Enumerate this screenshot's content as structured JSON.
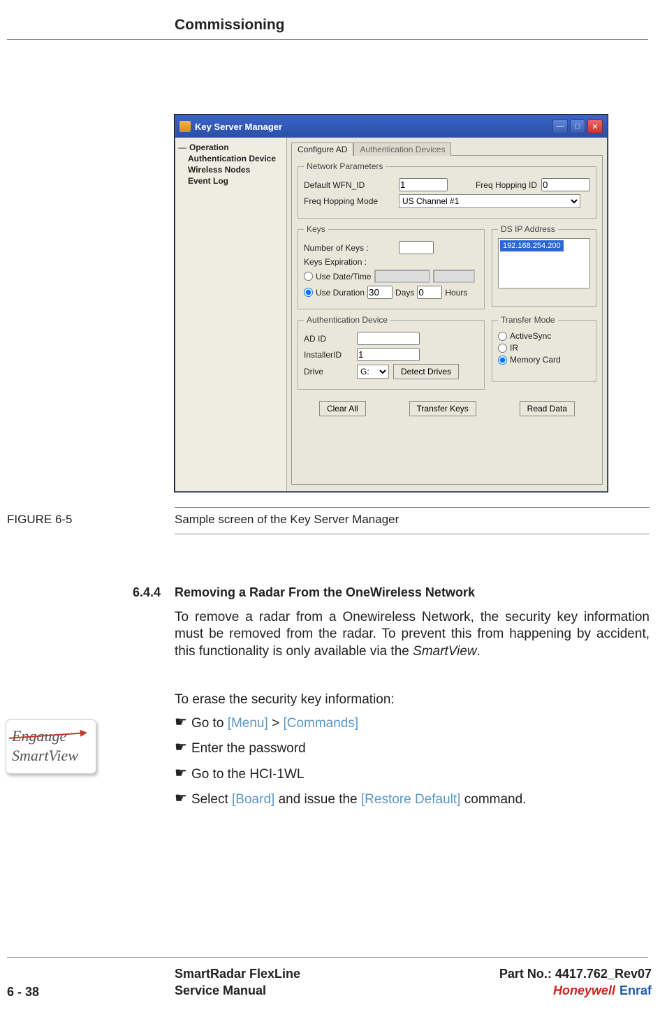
{
  "header": {
    "title": "Commissioning"
  },
  "screenshot": {
    "window_title": "Key Server Manager",
    "tree": {
      "root_symbol": "—",
      "root": "Operation",
      "items": [
        "Authentication Device",
        "Wireless Nodes",
        "Event Log"
      ]
    },
    "tabs": {
      "active": "Configure AD",
      "inactive": "Authentication Devices"
    },
    "network_params": {
      "legend": "Network Parameters",
      "default_wfn_label": "Default WFN_ID",
      "default_wfn_value": "1",
      "freq_hopping_id_label": "Freq Hopping ID",
      "freq_hopping_id_value": "0",
      "freq_hopping_mode_label": "Freq Hopping Mode",
      "freq_hopping_mode_value": "US Channel #1"
    },
    "keys": {
      "legend": "Keys",
      "num_keys_label": "Number of Keys :",
      "num_keys_value": "",
      "exp_label": "Keys Expiration :",
      "use_datetime_label": "Use Date/Time",
      "use_datetime_date": "",
      "use_datetime_time": "",
      "use_duration_label": "Use Duration",
      "duration_days": "30",
      "days_lbl": "Days",
      "duration_hours": "0",
      "hours_lbl": "Hours",
      "selected": "duration"
    },
    "ds_ip": {
      "legend": "DS IP Address",
      "ip": "192.168.254.200"
    },
    "auth_device": {
      "legend": "Authentication Device",
      "ad_id_label": "AD ID",
      "ad_id_value": "",
      "installer_id_label": "InstallerID",
      "installer_id_value": "1",
      "drive_label": "Drive",
      "drive_value": "G:",
      "detect_btn": "Detect Drives"
    },
    "transfer_mode": {
      "legend": "Transfer Mode",
      "options": [
        "ActiveSync",
        "IR",
        "Memory Card"
      ],
      "selected": "Memory Card"
    },
    "buttons": {
      "clear": "Clear All",
      "transfer": "Transfer Keys",
      "read": "Read Data"
    }
  },
  "figure": {
    "label": "FIGURE  6-5",
    "caption": "Sample screen of the Key Server Manager"
  },
  "section": {
    "num": "6.4.4",
    "title": "Removing a Radar From the OneWireless Network",
    "para1a": "To remove a radar from a Onewireless Network, the security key information must be removed from the radar. To prevent this from happening by accident, this functionality is only available via the ",
    "para1b_italic": "SmartView",
    "para1c": ".",
    "para2": "To erase the security key information:",
    "steps": {
      "s1a": "Go to ",
      "s1b_ref": "[Menu]",
      "s1c": " > ",
      "s1d_ref": "[Commands]",
      "s2": "Enter the password",
      "s3": "Go to the HCI-1WL",
      "s4a": "Select ",
      "s4b_ref": "[Board]",
      "s4c": " and issue the ",
      "s4d_ref": "[Restore Default]",
      "s4e": " command."
    }
  },
  "badge": {
    "strike": "Engauge",
    "name": "SmartView"
  },
  "footer": {
    "page": "6 - 38",
    "doc1": "SmartRadar FlexLine",
    "doc2": "Service Manual",
    "part": "Part No.: 4417.762_Rev07",
    "logo_h": "Honeywell",
    "logo_e": "Enraf"
  }
}
